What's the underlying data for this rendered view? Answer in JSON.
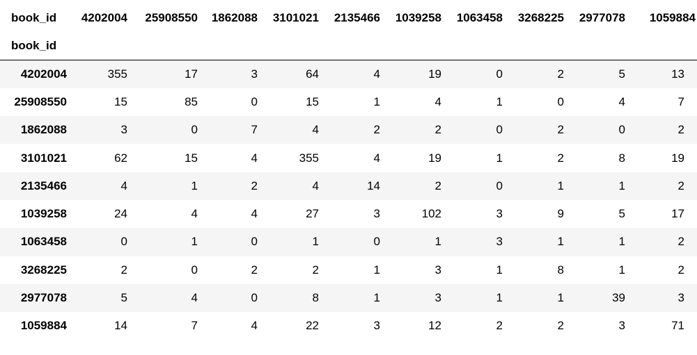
{
  "table": {
    "columns_name": "book_id",
    "index_name": "book_id",
    "columns": [
      "4202004",
      "25908550",
      "1862088",
      "3101021",
      "2135466",
      "1039258",
      "1063458",
      "3268225",
      "2977078",
      "1059884"
    ],
    "rows": [
      {
        "label": "4202004",
        "values": [
          "355",
          "17",
          "3",
          "64",
          "4",
          "19",
          "0",
          "2",
          "5",
          "13"
        ]
      },
      {
        "label": "25908550",
        "values": [
          "15",
          "85",
          "0",
          "15",
          "1",
          "4",
          "1",
          "0",
          "4",
          "7"
        ]
      },
      {
        "label": "1862088",
        "values": [
          "3",
          "0",
          "7",
          "4",
          "2",
          "2",
          "0",
          "2",
          "0",
          "2"
        ]
      },
      {
        "label": "3101021",
        "values": [
          "62",
          "15",
          "4",
          "355",
          "4",
          "19",
          "1",
          "2",
          "8",
          "19"
        ]
      },
      {
        "label": "2135466",
        "values": [
          "4",
          "1",
          "2",
          "4",
          "14",
          "2",
          "0",
          "1",
          "1",
          "2"
        ]
      },
      {
        "label": "1039258",
        "values": [
          "24",
          "4",
          "4",
          "27",
          "3",
          "102",
          "3",
          "9",
          "5",
          "17"
        ]
      },
      {
        "label": "1063458",
        "values": [
          "0",
          "1",
          "0",
          "1",
          "0",
          "1",
          "3",
          "1",
          "1",
          "2"
        ]
      },
      {
        "label": "3268225",
        "values": [
          "2",
          "0",
          "2",
          "2",
          "1",
          "3",
          "1",
          "8",
          "1",
          "2"
        ]
      },
      {
        "label": "2977078",
        "values": [
          "5",
          "4",
          "0",
          "8",
          "1",
          "3",
          "1",
          "1",
          "39",
          "3"
        ]
      },
      {
        "label": "1059884",
        "values": [
          "14",
          "7",
          "4",
          "22",
          "3",
          "12",
          "2",
          "2",
          "3",
          "71"
        ]
      }
    ]
  }
}
